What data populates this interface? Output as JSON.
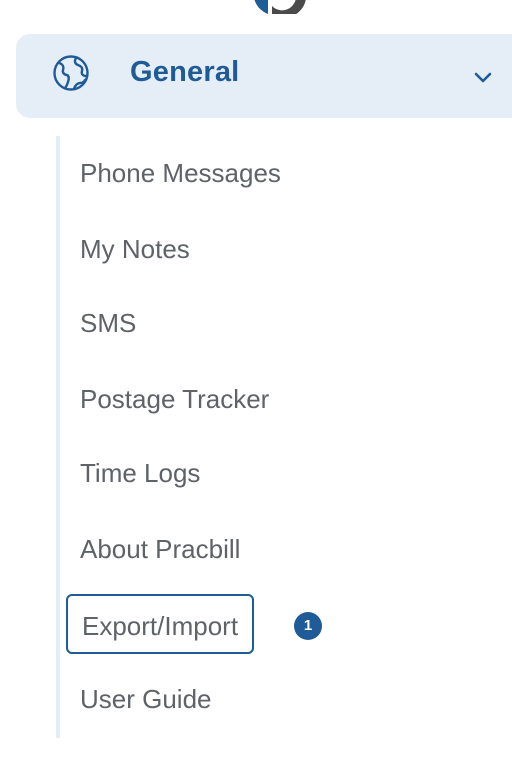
{
  "section": {
    "title": "General",
    "icon": "globe-icon",
    "expand_icon": "chevron-down-icon"
  },
  "menu": {
    "items": [
      {
        "label": "Phone Messages"
      },
      {
        "label": "My Notes"
      },
      {
        "label": "SMS"
      },
      {
        "label": "Postage Tracker"
      },
      {
        "label": "Time Logs"
      },
      {
        "label": "About Pracbill"
      },
      {
        "label": "Export/Import",
        "badge": "1",
        "focused": true
      },
      {
        "label": "User Guide"
      }
    ]
  },
  "colors": {
    "accent": "#1f5b96",
    "header_bg": "#e5eef7",
    "item_text": "#5f6368",
    "rail": "#e4ecf4"
  }
}
